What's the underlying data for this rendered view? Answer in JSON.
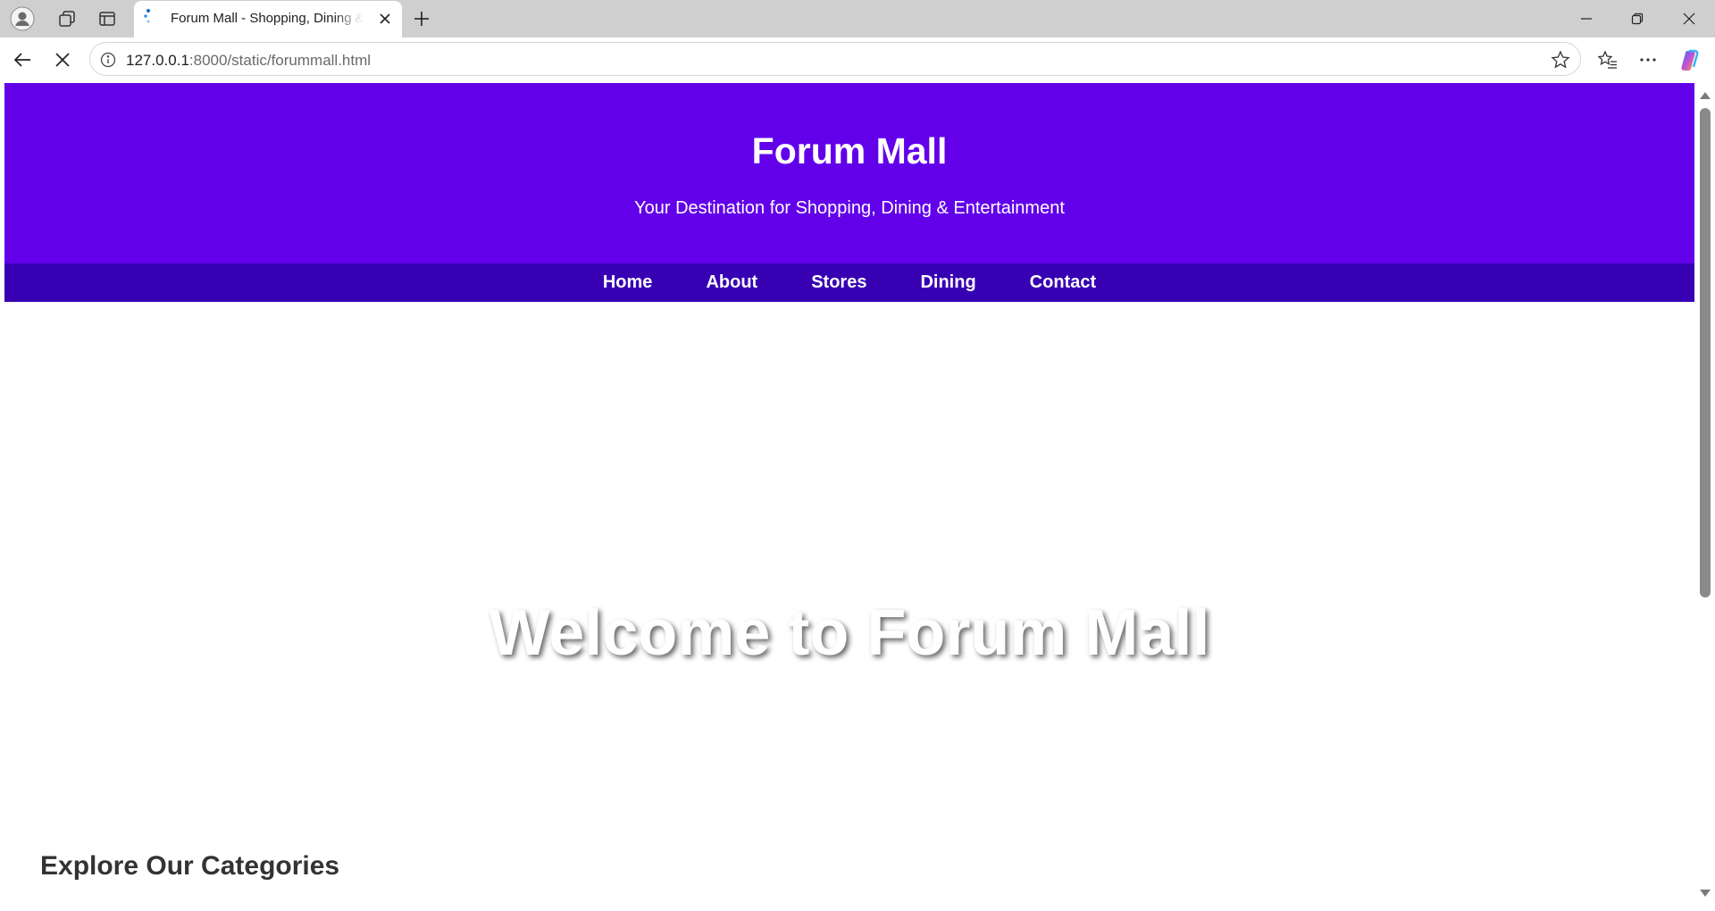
{
  "browser": {
    "tab_title": "Forum Mall - Shopping, Dining & Entertainment",
    "url_host": "127.0.0.1",
    "url_path": ":8000/static/forummall.html",
    "icons": {
      "profile": "profile-icon",
      "workspaces": "workspaces-icon",
      "tab_actions": "vertical-tabs-icon",
      "favicon": "loading-favicon",
      "close_tab": "close-icon",
      "new_tab": "plus-icon",
      "minimize": "minimize-icon",
      "restore": "restore-icon",
      "close_window": "close-icon",
      "back": "back-arrow-icon",
      "stop": "stop-loading-icon",
      "site_info": "info-icon",
      "favorite": "star-icon",
      "favorites_list": "favorites-icon",
      "more": "ellipsis-icon",
      "copilot": "copilot-icon"
    }
  },
  "site": {
    "title": "Forum Mall",
    "tagline": "Your Destination for Shopping, Dining & Entertainment",
    "nav": [
      "Home",
      "About",
      "Stores",
      "Dining",
      "Contact"
    ],
    "hero_heading": "Welcome to Forum Mall",
    "categories_heading": "Explore Our Categories",
    "colors": {
      "header_bg": "#6200ea",
      "nav_bg": "#3700b3",
      "text_light": "#ffffff",
      "heading_dark": "#333333"
    }
  }
}
